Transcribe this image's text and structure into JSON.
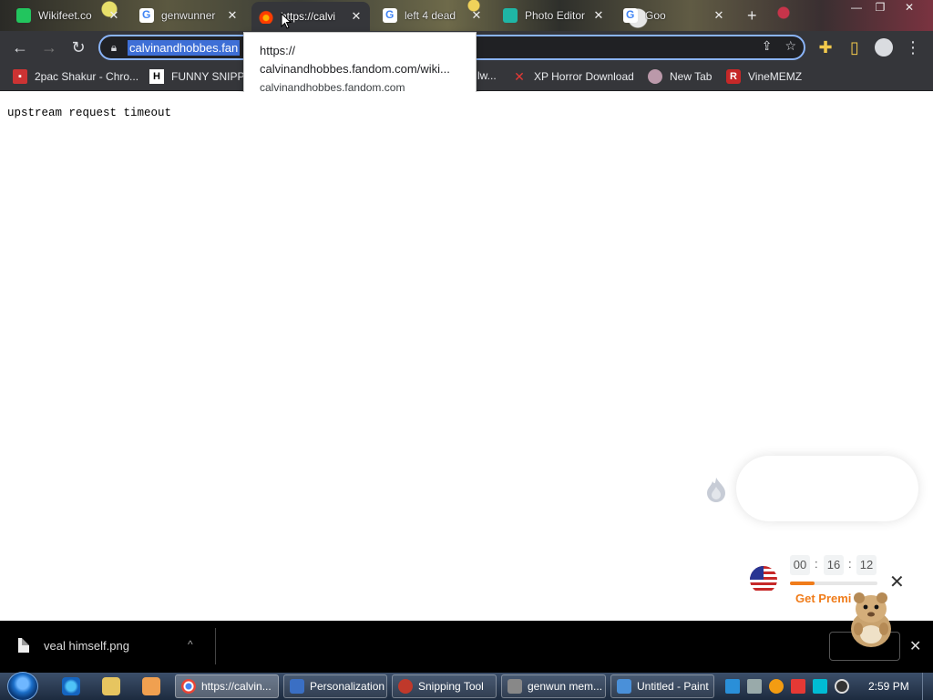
{
  "browser": {
    "tabs": [
      {
        "label": "Wikifeet.co",
        "icon": "green-square-icon"
      },
      {
        "label": "genwunner",
        "icon": "google-icon"
      },
      {
        "label": "https://calvi",
        "icon": "fire-icon",
        "active": true
      },
      {
        "label": "left 4 dead",
        "icon": "google-icon"
      },
      {
        "label": "Photo Editor",
        "icon": "photo-editor-icon"
      },
      {
        "label": "Goo",
        "icon": "google-icon"
      }
    ],
    "new_tab_label": "+",
    "address": {
      "url_selected": "calvinandhobbes.fan",
      "lock_icon": "lock-icon"
    },
    "bookmarks": [
      {
        "label": "2pac Shakur - Chro...",
        "icon": "bag-icon"
      },
      {
        "label": "FUNNY SNIPPI",
        "icon": "h-icon"
      },
      {
        "label": "lw...",
        "icon": "generic-icon"
      },
      {
        "label": "XP Horror Download",
        "icon": "x-icon"
      },
      {
        "label": "New Tab",
        "icon": "globe-icon"
      },
      {
        "label": "VineMEMZ",
        "icon": "r-icon"
      }
    ],
    "tooltip": {
      "line1": "https://",
      "line2": "calvinandhobbes.fandom.com/wiki...",
      "host": "calvinandhobbes.fandom.com"
    }
  },
  "page": {
    "error_text": "upstream request timeout"
  },
  "vpn": {
    "timer": {
      "hours": "00",
      "minutes": "16",
      "seconds": "12",
      "sep": ":"
    },
    "progress": 0.28,
    "premium_label": "Get Premi",
    "close_label": "✕",
    "accent": "#f07c1a"
  },
  "downloads": {
    "filename": "veal himself.png",
    "chevron": "^",
    "close_label": "✕"
  },
  "taskbar": {
    "items": [
      {
        "label": "https://calvin...",
        "active": true,
        "color": "#d44"
      },
      {
        "label": "Personalization",
        "active": false,
        "color": "#3a6fc4"
      },
      {
        "label": "Snipping Tool",
        "active": false,
        "color": "#c0392b"
      },
      {
        "label": "genwun mem...",
        "active": false,
        "color": "#888"
      },
      {
        "label": "Untitled - Paint",
        "active": false,
        "color": "#4a90d9"
      }
    ],
    "clock": "2:59 PM"
  }
}
